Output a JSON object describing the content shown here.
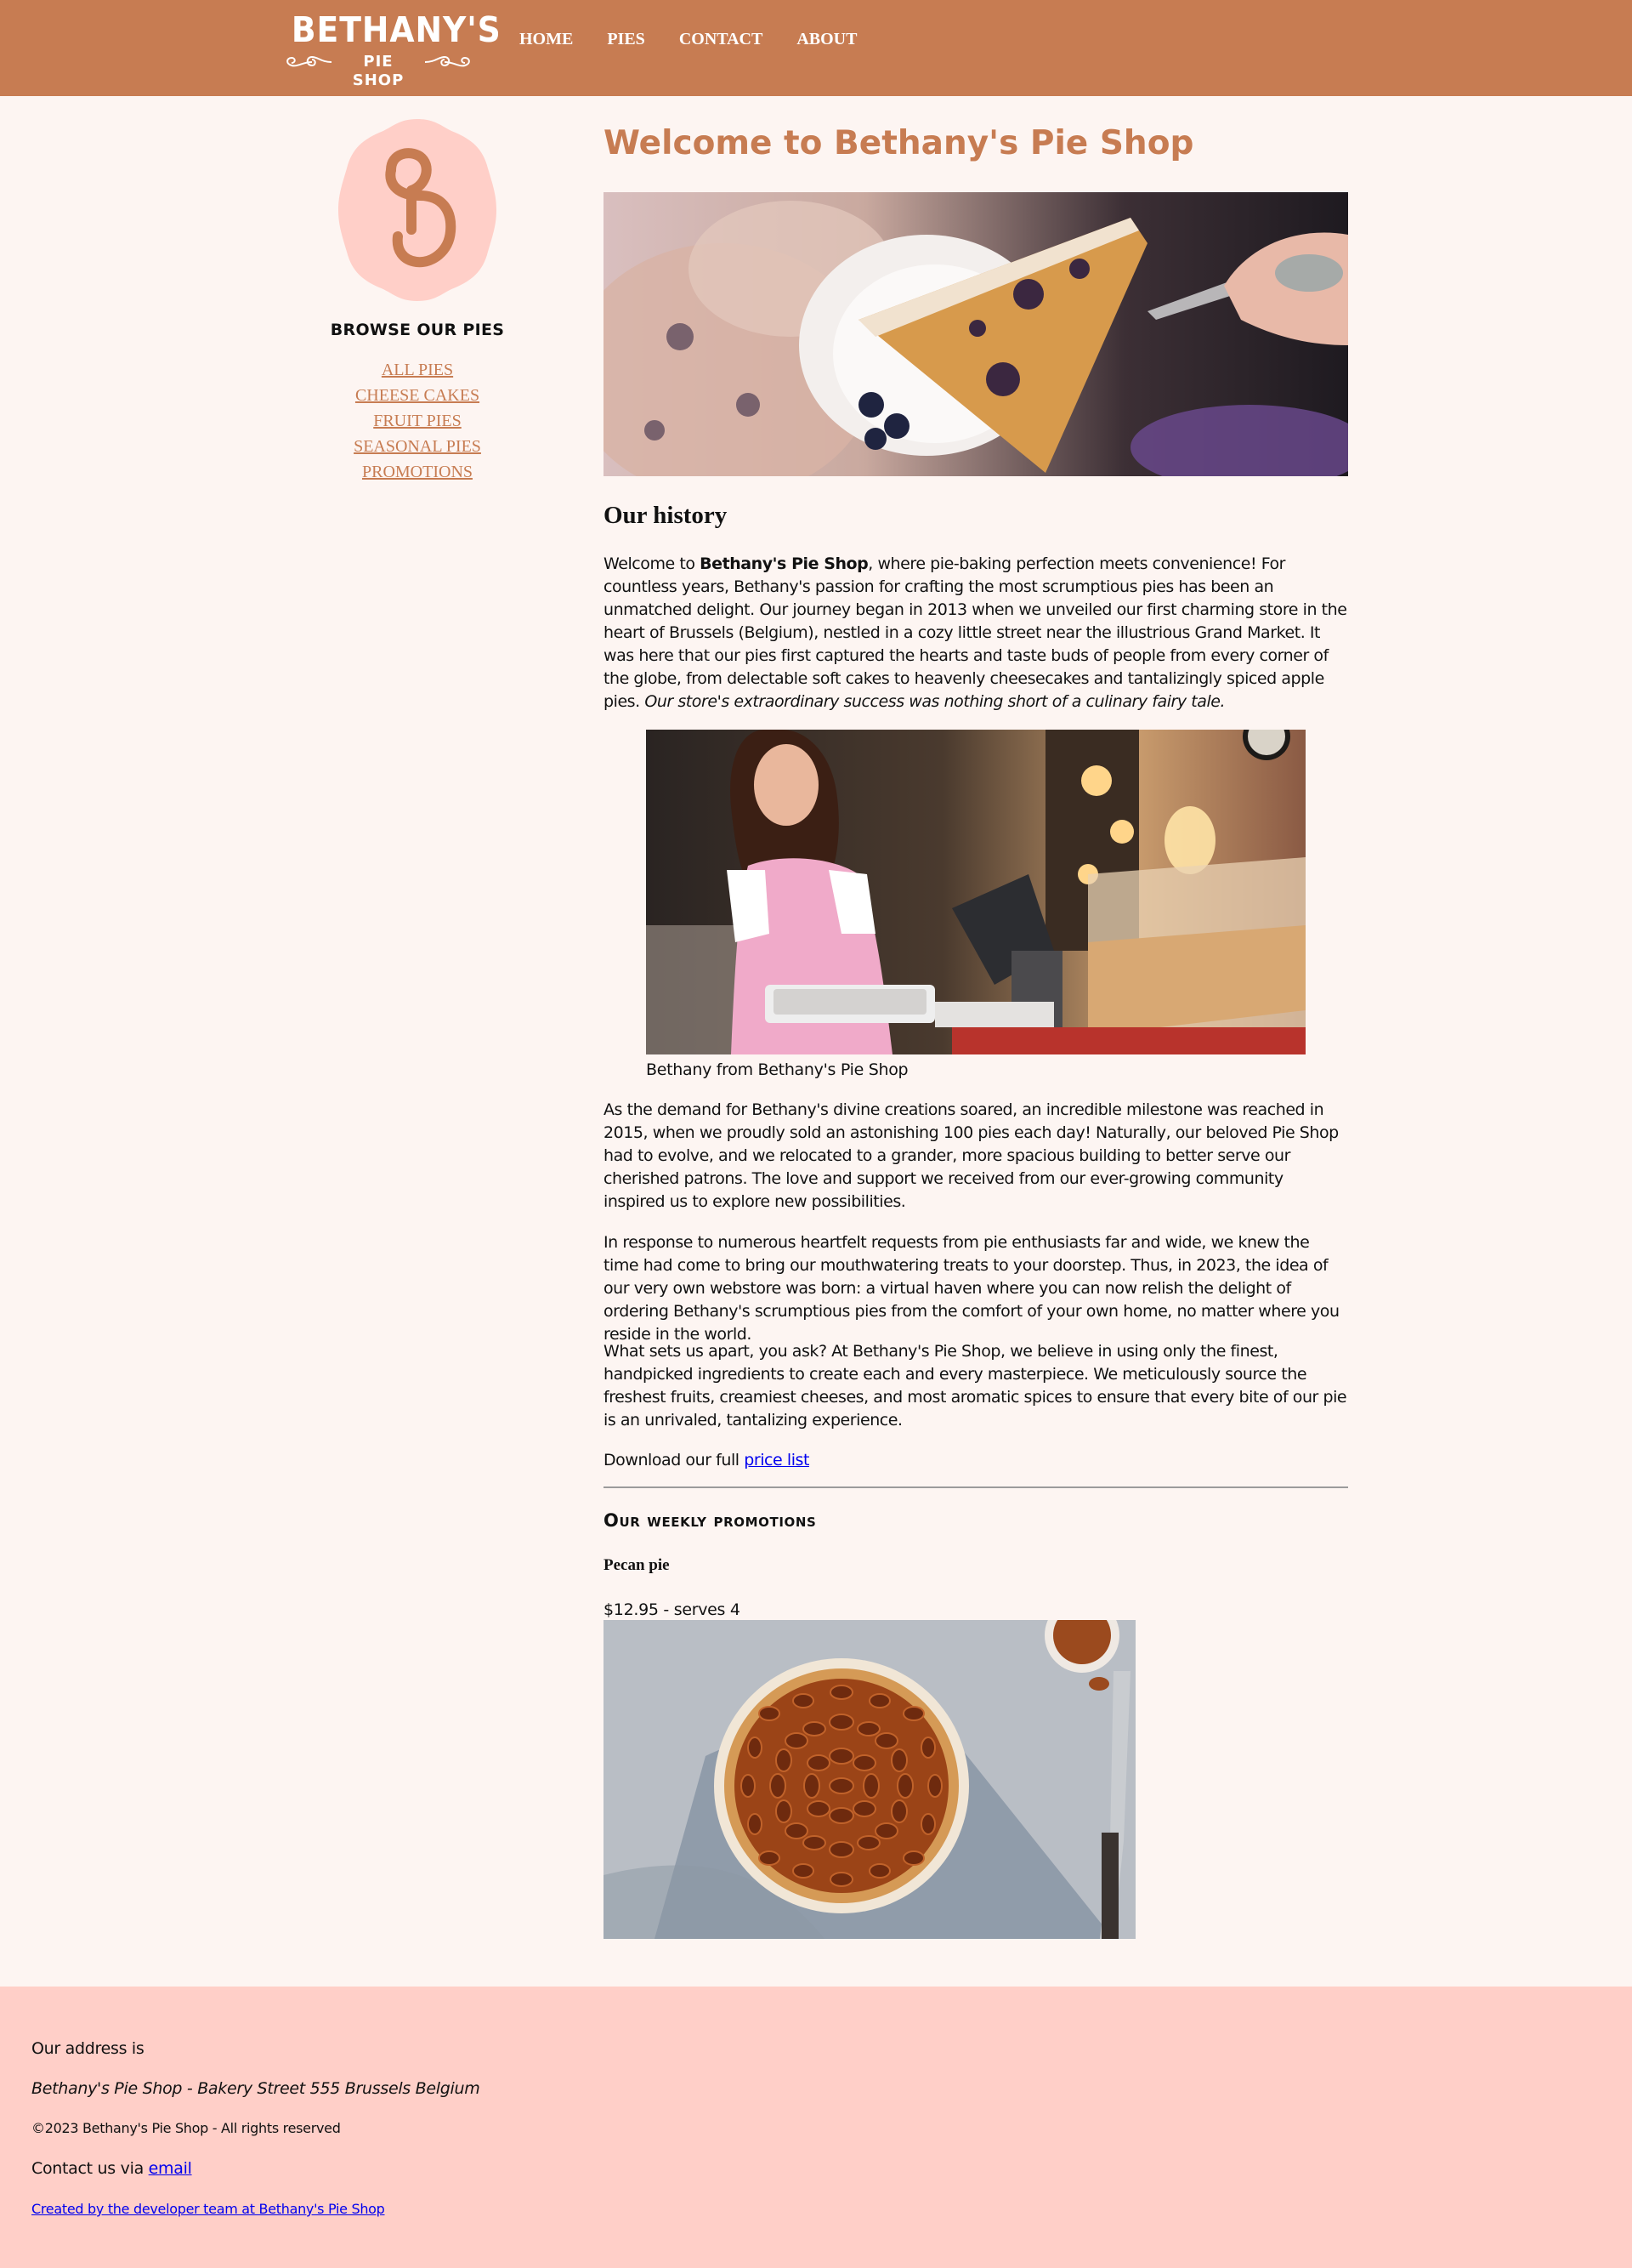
{
  "header": {
    "logo_word": "BETHANY'S",
    "logo_sub": "PIE SHOP",
    "nav": [
      "HOME",
      "PIES",
      "CONTACT",
      "ABOUT"
    ]
  },
  "sidebar": {
    "monogram": "B",
    "browse_title": "BROWSE OUR PIES",
    "categories": [
      "ALL PIES",
      "CHEESE CAKES",
      "FRUIT PIES",
      "SEASONAL PIES",
      "PROMOTIONS"
    ]
  },
  "main": {
    "title": "Welcome to Bethany's Pie Shop",
    "history_heading": "Our history",
    "p1": {
      "before": "Welcome to ",
      "bold": "Bethany's Pie Shop",
      "after": ", where pie-baking perfection meets convenience! For countless years, Bethany's passion for crafting the most scrumptious pies has been an unmatched delight. Our journey began in 2013 when we unveiled our first charming store in the heart of Brussels (Belgium), nestled in a cozy little street near the illustrious Grand Market. It was here that our pies first captured the hearts and taste buds of people from every corner of the globe, from delectable soft cakes to heavenly cheesecakes and tantalizingly spiced apple pies. ",
      "italic": "Our store's extraordinary success was nothing short of a culinary fairy tale."
    },
    "caption": "Bethany from Bethany's Pie Shop",
    "p2": "As the demand for Bethany's divine creations soared, an incredible milestone was reached in 2015, when we proudly sold an astonishing 100 pies each day! Naturally, our beloved Pie Shop had to evolve, and we relocated to a grander, more spacious building to better serve our cherished patrons. The love and support we received from our ever-growing community inspired us to explore new possibilities.",
    "p3": "In response to numerous heartfelt requests from pie enthusiasts far and wide, we knew the time had come to bring our mouthwatering treats to your doorstep. Thus, in 2023, the idea of our very own webstore was born: a virtual haven where you can now relish the delight of ordering Bethany's scrumptious pies from the comfort of your own home, no matter where you reside in the world.",
    "p4": "What sets us apart, you ask? At Bethany's Pie Shop, we believe in using only the finest, handpicked ingredients to create each and every masterpiece. We meticulously source the freshest fruits, creamiest cheeses, and most aromatic spices to ensure that every bite of our pie is an unrivaled, tantalizing experience.",
    "p5": {
      "text": "Download our full ",
      "link": "price list"
    },
    "promos_heading": "Our weekly promotions",
    "promo": {
      "name": "Pecan pie",
      "price": "$12.95 - serves 4"
    }
  },
  "footer": {
    "address_label": "Our address is",
    "address": "Bethany's Pie Shop - Bakery Street 555 Brussels Belgium",
    "copyright": "©2023 Bethany's Pie Shop - All rights reserved",
    "contact_text": "Contact us via ",
    "contact_link": "email",
    "credit": "Created by the developer team at Bethany's Pie Shop"
  },
  "colors": {
    "brand": "#c77c52",
    "page_bg": "#fdf5f2",
    "footer_bg": "#ffcfc8",
    "monogram_bg": "#ffcfc8",
    "link": "#0000ee"
  }
}
